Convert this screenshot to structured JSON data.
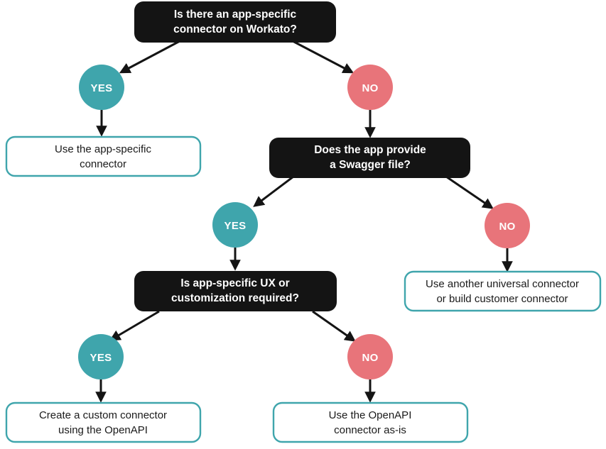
{
  "diagram": {
    "title": "Workato connector decision flowchart",
    "colors": {
      "dark_node": "#141414",
      "yes_circle": "#3fa5ac",
      "no_circle": "#e8747a",
      "outline_border": "#3fa5ac",
      "background": "#ffffff",
      "arrow": "#141414",
      "dark_node_text": "#ffffff",
      "outline_text": "#1a1a1a",
      "circle_text": "#ffffff"
    },
    "questions": {
      "q1": {
        "line1": "Is there an app-specific",
        "line2": "connector on Workato?"
      },
      "q2": {
        "line1": "Does the app provide",
        "line2": "a Swagger file?"
      },
      "q3": {
        "line1": "Is app-specific UX or",
        "line2": "customization required?"
      }
    },
    "decisions": {
      "yes": "YES",
      "no": "NO"
    },
    "outcomes": {
      "o1": {
        "line1": "Use the app-specific",
        "line2": "connector"
      },
      "o2": {
        "line1": "Use another universal connector",
        "line2": "or build customer connector"
      },
      "o3": {
        "line1": "Create a custom connector",
        "line2": "using the OpenAPI"
      },
      "o4": {
        "line1": "Use the OpenAPI",
        "line2": "connector as-is"
      }
    }
  }
}
